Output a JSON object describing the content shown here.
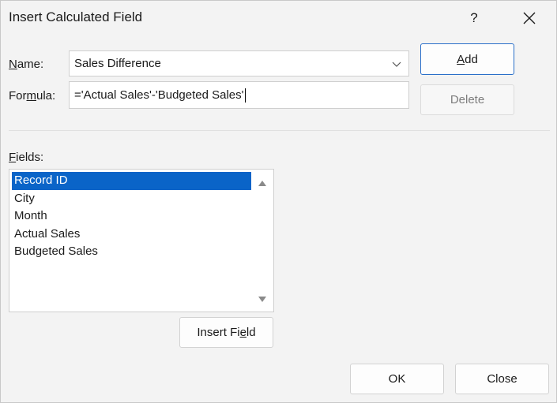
{
  "dialog": {
    "title": "Insert Calculated Field",
    "help_label": "?"
  },
  "name": {
    "label_underlined": "N",
    "label_rest": "ame:",
    "value": "Sales Difference"
  },
  "formula": {
    "label_before": "For",
    "label_underlined": "m",
    "label_after": "ula:",
    "value": "='Actual Sales'-'Budgeted Sales'"
  },
  "buttons": {
    "add_underlined": "A",
    "add_rest": "dd",
    "delete": "Delete",
    "insert_field_before": "Insert Fi",
    "insert_field_underlined": "e",
    "insert_field_after": "ld",
    "ok": "OK",
    "close": "Close"
  },
  "fields": {
    "label_underlined": "F",
    "label_rest": "ields:",
    "items": [
      "Record ID",
      "City",
      "Month",
      "Actual Sales",
      "Budgeted Sales"
    ],
    "selected": "Record ID"
  },
  "colors": {
    "selection": "#0a64c8",
    "primary_border": "#2a6fc9"
  },
  "icons": [
    "help-icon",
    "close-icon",
    "chevron-down-icon",
    "scroll-up-icon",
    "scroll-down-icon"
  ]
}
